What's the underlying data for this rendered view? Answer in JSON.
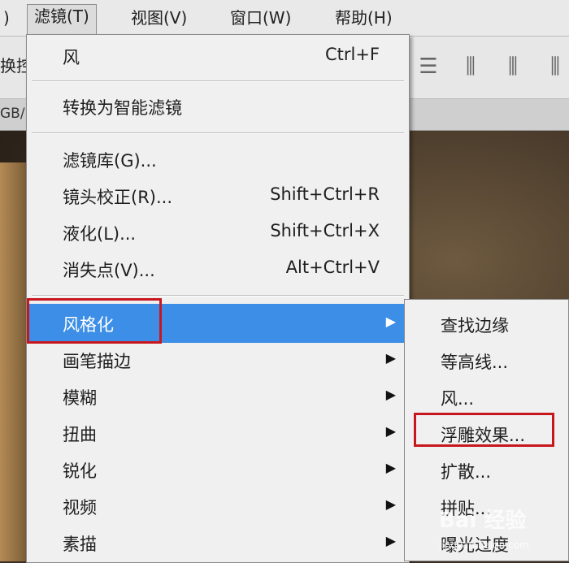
{
  "menubar": {
    "items": [
      {
        "label": ")"
      },
      {
        "label": "滤镜(T)"
      },
      {
        "label": "视图(V)"
      },
      {
        "label": "窗口(W)"
      },
      {
        "label": "帮助(H)"
      }
    ]
  },
  "optionsbar": {
    "left_text": "换控"
  },
  "document_tab": {
    "label": "GB/"
  },
  "filter_menu": {
    "items": [
      {
        "label": "风",
        "shortcut": "Ctrl+F"
      },
      {
        "label": "转换为智能滤镜",
        "shortcut": ""
      },
      {
        "label": "滤镜库(G)...",
        "shortcut": ""
      },
      {
        "label": "镜头校正(R)...",
        "shortcut": "Shift+Ctrl+R"
      },
      {
        "label": "液化(L)...",
        "shortcut": "Shift+Ctrl+X"
      },
      {
        "label": "消失点(V)...",
        "shortcut": "Alt+Ctrl+V"
      },
      {
        "label": "风格化",
        "has_submenu": true
      },
      {
        "label": "画笔描边",
        "has_submenu": true
      },
      {
        "label": "模糊",
        "has_submenu": true
      },
      {
        "label": "扭曲",
        "has_submenu": true
      },
      {
        "label": "锐化",
        "has_submenu": true
      },
      {
        "label": "视频",
        "has_submenu": true
      },
      {
        "label": "素描",
        "has_submenu": true
      }
    ],
    "arrow": "▶"
  },
  "stylize_submenu": {
    "items": [
      {
        "label": "查找边缘"
      },
      {
        "label": "等高线..."
      },
      {
        "label": "风..."
      },
      {
        "label": "浮雕效果..."
      },
      {
        "label": "扩散..."
      },
      {
        "label": "拼贴..."
      },
      {
        "label": "曝光过度"
      }
    ]
  },
  "watermark": {
    "text": "Bai 经验",
    "sub": "jingyan.baidu.com"
  },
  "colors": {
    "highlight": "#3d8ee6",
    "callout_red": "#c8161d",
    "menu_bg": "#f0f0f0"
  }
}
